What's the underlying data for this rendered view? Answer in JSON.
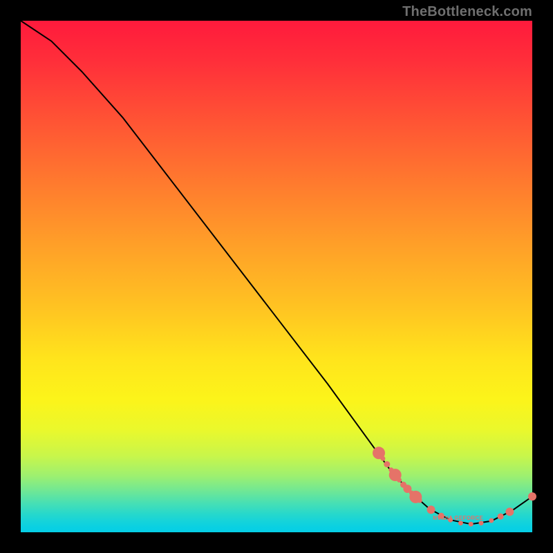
{
  "watermark": "TheBottleneck.com",
  "chart_data": {
    "type": "line",
    "title": "",
    "xlabel": "",
    "ylabel": "",
    "xlim": [
      0,
      100
    ],
    "ylim": [
      0,
      100
    ],
    "curve": [
      {
        "x": 0,
        "y": 100
      },
      {
        "x": 6,
        "y": 96
      },
      {
        "x": 12,
        "y": 90
      },
      {
        "x": 20,
        "y": 81
      },
      {
        "x": 30,
        "y": 68
      },
      {
        "x": 40,
        "y": 55
      },
      {
        "x": 50,
        "y": 42
      },
      {
        "x": 60,
        "y": 29
      },
      {
        "x": 68,
        "y": 18
      },
      {
        "x": 72,
        "y": 12.5
      },
      {
        "x": 76,
        "y": 8
      },
      {
        "x": 80,
        "y": 4.5
      },
      {
        "x": 84,
        "y": 2.4
      },
      {
        "x": 88,
        "y": 1.6
      },
      {
        "x": 92,
        "y": 2.2
      },
      {
        "x": 96,
        "y": 4.2
      },
      {
        "x": 100,
        "y": 7
      }
    ],
    "markers_left_cluster": [
      {
        "x": 70.0,
        "y": 15.5,
        "size": "big"
      },
      {
        "x": 70.8,
        "y": 14.4,
        "size": "sm"
      },
      {
        "x": 71.6,
        "y": 13.3,
        "size": "smA"
      },
      {
        "x": 72.4,
        "y": 12.2,
        "size": "sm"
      },
      {
        "x": 73.2,
        "y": 11.2,
        "size": "big"
      },
      {
        "x": 74.0,
        "y": 10.2,
        "size": "sm"
      },
      {
        "x": 74.8,
        "y": 9.3,
        "size": "smA"
      },
      {
        "x": 75.6,
        "y": 8.5,
        "size": "mid"
      },
      {
        "x": 76.4,
        "y": 7.7,
        "size": "sm"
      },
      {
        "x": 77.2,
        "y": 6.9,
        "size": "big"
      },
      {
        "x": 78.0,
        "y": 6.2,
        "size": "sm"
      }
    ],
    "markers_valley": [
      {
        "x": 80.2,
        "y": 4.4,
        "size": "mid"
      },
      {
        "x": 82.2,
        "y": 3.2,
        "size": "smA"
      },
      {
        "x": 84.0,
        "y": 2.4,
        "size": "sm"
      },
      {
        "x": 86.0,
        "y": 1.8,
        "size": "sm"
      },
      {
        "x": 88.0,
        "y": 1.6,
        "size": "sm"
      },
      {
        "x": 90.0,
        "y": 1.8,
        "size": "sm"
      },
      {
        "x": 92.0,
        "y": 2.3,
        "size": "sm"
      },
      {
        "x": 93.8,
        "y": 3.1,
        "size": "smA"
      },
      {
        "x": 95.6,
        "y": 4.0,
        "size": "mid"
      }
    ],
    "markers_tail": [
      {
        "x": 100.0,
        "y": 7.0,
        "size": "mid"
      }
    ],
    "annotation": {
      "text": "NVIDIA GEFORCE",
      "x": 85.5,
      "y": 2.7
    }
  }
}
